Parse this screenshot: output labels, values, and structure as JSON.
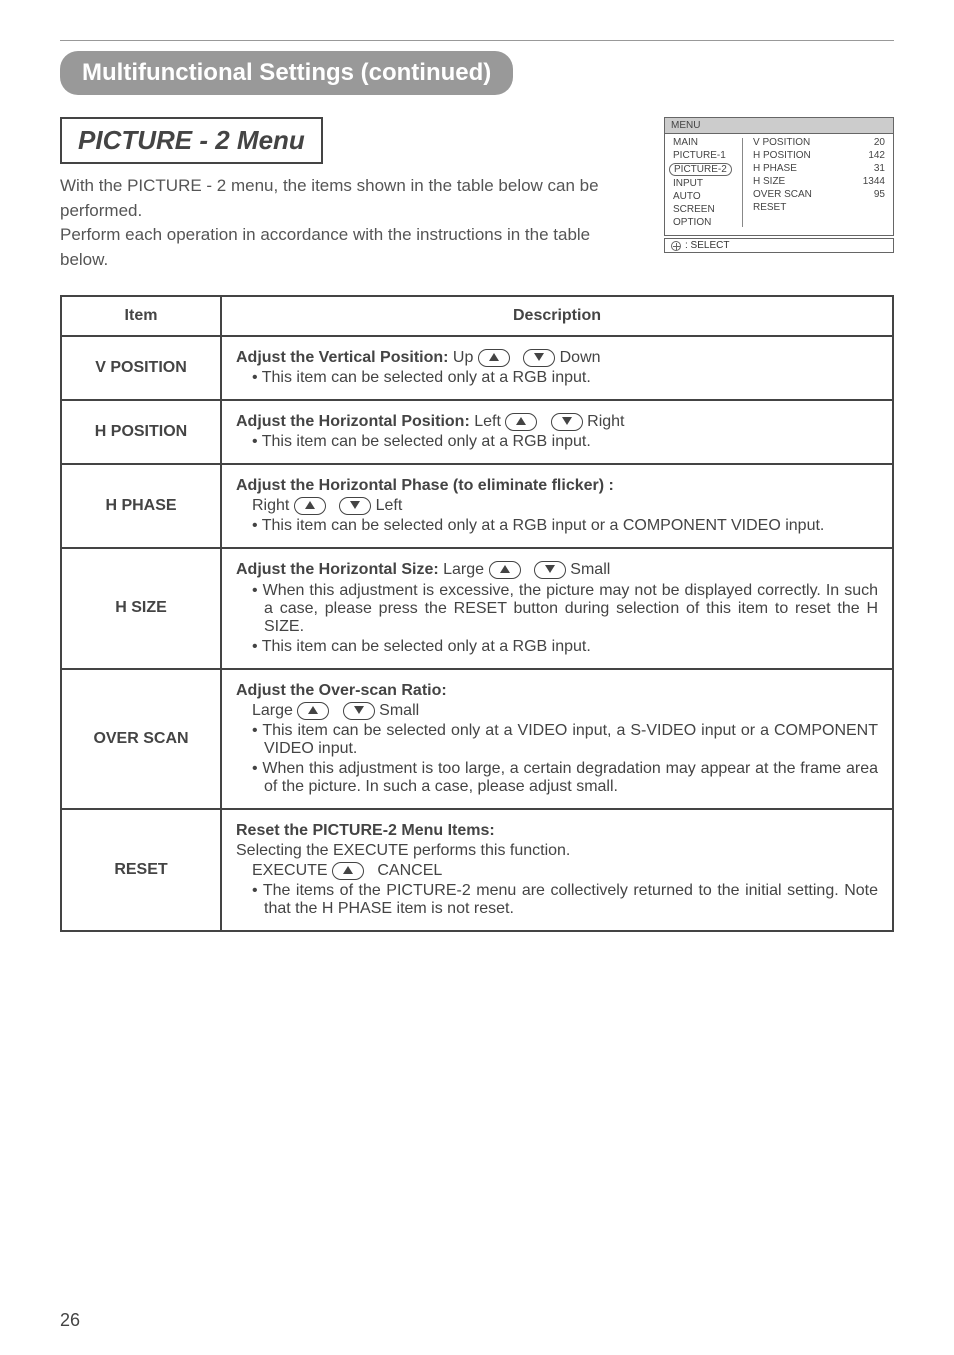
{
  "section_header": "Multifunctional Settings (continued)",
  "submenu_title": "PICTURE - 2 Menu",
  "intro_p1": "With the PICTURE - 2 menu, the items shown in the table below can be performed.",
  "intro_p2": "Perform each operation in accordance with the instructions in the table below.",
  "page_number": "26",
  "osd": {
    "title": "MENU",
    "left": [
      "MAIN",
      "PICTURE-1",
      "PICTURE-2",
      "INPUT",
      "AUTO",
      "SCREEN",
      "OPTION"
    ],
    "selected_index": 2,
    "right": [
      {
        "label": "V POSITION",
        "val": "20"
      },
      {
        "label": "H POSITION",
        "val": "142"
      },
      {
        "label": "H PHASE",
        "val": "31"
      },
      {
        "label": "H SIZE",
        "val": "1344"
      },
      {
        "label": "OVER SCAN",
        "val": "95"
      },
      {
        "label": "RESET",
        "val": ""
      }
    ],
    "footer": ": SELECT"
  },
  "table": {
    "head_item": "Item",
    "head_desc": "Description",
    "rows": [
      {
        "item": "V POSITION",
        "lead": "Adjust the Vertical Position:",
        "opt_a": "Up",
        "opt_b": "Down",
        "bullets": [
          "• This item can be selected only at a RGB input."
        ]
      },
      {
        "item": "H POSITION",
        "lead": "Adjust the Horizontal Position:",
        "opt_a": "Left",
        "opt_b": "Right",
        "bullets": [
          "• This item can be selected only at a RGB input."
        ]
      },
      {
        "item": "H PHASE",
        "lead": "Adjust the Horizontal Phase (to eliminate flicker) :",
        "opt_a": "Right",
        "opt_b": "Left",
        "bullets": [
          "• This item can be selected only at a RGB input or a COMPONENT VIDEO input."
        ]
      },
      {
        "item": "H SIZE",
        "lead": "Adjust the Horizontal Size:",
        "opt_a": "Large",
        "opt_b": "Small",
        "bullets": [
          "• When this adjustment is excessive, the picture may not be displayed correctly. In such a case, please press the RESET button during selection of this item to reset the H SIZE.",
          "• This item can be selected only at a RGB input."
        ]
      },
      {
        "item": "OVER SCAN",
        "lead": "Adjust the Over-scan Ratio:",
        "opt_a": "Large",
        "opt_b": "Small",
        "bullets": [
          "• This item can be selected only at a VIDEO input, a S-VIDEO input or a COMPONENT VIDEO input.",
          "• When this adjustment is too large, a certain degradation may appear at the frame area of the picture. In such a case, please adjust small."
        ]
      },
      {
        "item": "RESET",
        "lead": "Reset the PICTURE-2 Menu Items:",
        "line2": "Selecting the EXECUTE performs this function.",
        "opt_a": "EXECUTE",
        "opt_b": "CANCEL",
        "bullets": [
          "• The items of the PICTURE-2 menu are collectively returned to the initial setting. Note that the H PHASE item is not reset."
        ]
      }
    ]
  }
}
